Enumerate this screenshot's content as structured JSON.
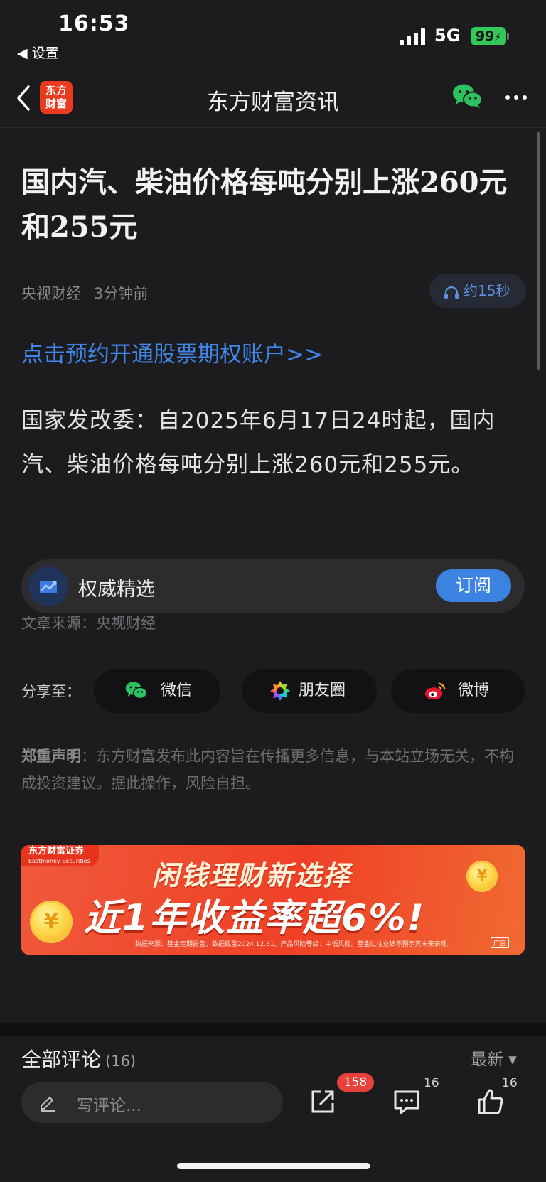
{
  "status_bar": {
    "time": "16:53",
    "back_app": "◀ 设置",
    "network": "5G",
    "battery": "99"
  },
  "nav": {
    "logo_line1": "东方",
    "logo_line2": "财富",
    "title": "东方财富资讯"
  },
  "article": {
    "title": "国内汽、柴油价格每吨分别上涨260元和255元",
    "source_name": "央视财经",
    "published": "3分钟前",
    "listen_label": "约15秒",
    "promo_link": "点击预约开通股票期权账户>>",
    "body": "国家发改委：自2025年6月17日24时起，国内汽、柴油价格每吨分别上涨260元和255元。",
    "subscribe_card": {
      "label": "权威精选",
      "button": "订阅"
    },
    "source_line": "文章来源：央视财经",
    "share": {
      "label": "分享至：",
      "wechat": "微信",
      "moments": "朋友圈",
      "weibo": "微博"
    },
    "disclaimer_title": "郑重声明",
    "disclaimer_text": "：东方财富发布此内容旨在传播更多信息，与本站立场无关，不构成投资建议。据此操作，风险自担。"
  },
  "ad_banner": {
    "brand": "东方财富证券",
    "brand_en": "Eastmoney Securities",
    "headline": "闲钱理财新选择",
    "subheadline": "近1年收益率超6%!",
    "note": "数据来源：基金定期报告，数据截至2024.12.31。产品风险等级：中低风险。基金过往业绩不预示其未来表现。",
    "ad_tag": "广告"
  },
  "comments": {
    "title": "全部评论",
    "count": "(16)",
    "sort": "最新 ▾"
  },
  "bottom_bar": {
    "placeholder": "写评论...",
    "share_count": "158",
    "comment_count": "16",
    "like_count": "16"
  },
  "colors": {
    "background": "#1c1c1e",
    "link_blue": "#3f86e8",
    "accent_red": "#ea3a1f",
    "badge_red": "#e8413c",
    "battery_green": "#34c759"
  }
}
